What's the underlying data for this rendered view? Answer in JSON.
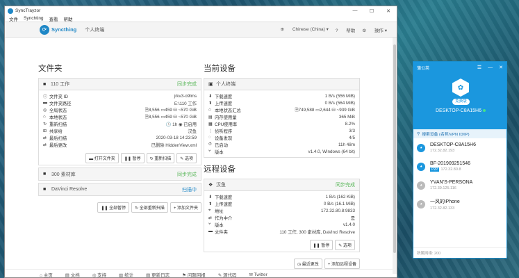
{
  "window": {
    "title": "SyncTrayzor",
    "min": "—",
    "max": "☐",
    "close": "✕"
  },
  "menu": [
    "文件",
    "Synchting",
    "查看",
    "帮助"
  ],
  "nav": {
    "logo": "Syncthing",
    "device": "个人终端",
    "language": "Chinese (China)",
    "help": "帮助",
    "actions": "操作"
  },
  "folders": {
    "heading": "文件夹",
    "main": {
      "name": "110 工作",
      "status": "同步完成",
      "rows": [
        {
          "icon": "ⓘ",
          "label": "文件夹 ID",
          "value": "jrkv3-o9lms"
        },
        {
          "icon": "▬",
          "label": "文件夹路径",
          "value": "E:\\110 工作"
        },
        {
          "icon": "◎",
          "label": "全局状态",
          "value": "🗎8,556  ▭459  ⛁ ~570 GiB"
        },
        {
          "icon": "⌂",
          "label": "本地状态",
          "value": "🗎8,556  ▭459  ⛁ ~570 GiB"
        },
        {
          "icon": "↻",
          "label": "重新扫描",
          "value": "🕓 1h  ◉ 已启用"
        },
        {
          "icon": "⊞",
          "label": "共享给",
          "value": "汉鱼"
        },
        {
          "icon": "⇄",
          "label": "最后扫描",
          "value": "2020-03-18 14:23:59"
        },
        {
          "icon": "⇄",
          "label": "最后更改",
          "value": "已删除 HiddenView.xml"
        }
      ],
      "buttons": [
        "打开文件夹",
        "暂停",
        "重新扫描",
        "选项"
      ]
    },
    "others": [
      {
        "name": "300 素材库",
        "status": "同步完成",
        "color": "green"
      },
      {
        "name": "DaVinci Resolve",
        "status": "扫描中",
        "color": "blue"
      }
    ],
    "buttons": [
      "全部暂停",
      "全部重新扫描",
      "添加文件夹"
    ]
  },
  "this_device": {
    "heading": "当前设备",
    "name": "个人终端",
    "rows": [
      {
        "icon": "⬇",
        "label": "下载速度",
        "value": "1 B/s (556 MiB)"
      },
      {
        "icon": "⬆",
        "label": "上传速度",
        "value": "0 B/s (564 MiB)"
      },
      {
        "icon": "⌂",
        "label": "本地状态汇总",
        "value": "🗎749,588  ▭2,644  ⛁ ~939 GiB"
      },
      {
        "icon": "▤",
        "label": "内存使用量",
        "value": "365 MiB"
      },
      {
        "icon": "▦",
        "label": "CPU使用率",
        "value": "8.2%"
      },
      {
        "icon": "⋮",
        "label": "侦听程序",
        "value": "3/3",
        "green": true
      },
      {
        "icon": "◌",
        "label": "设备发现",
        "value": "4/5"
      },
      {
        "icon": "⏱",
        "label": "已启动",
        "value": "11h 48m"
      },
      {
        "icon": "⑂",
        "label": "版本",
        "value": "v1.4.0, Windows (64 bit)"
      }
    ]
  },
  "remote": {
    "heading": "远程设备",
    "device": {
      "name": "汉鱼",
      "status": "同步完成",
      "rows": [
        {
          "icon": "⬇",
          "label": "下载速度",
          "value": "1 B/s (162 KiB)"
        },
        {
          "icon": "⬆",
          "label": "上传速度",
          "value": "0 B/s (16.1 MiB)"
        },
        {
          "icon": "⌖",
          "label": "地址",
          "value": "172.32.80.8:9833"
        },
        {
          "icon": "⇄",
          "label": "作为中介",
          "value": "是"
        },
        {
          "icon": "⑂",
          "label": "版本",
          "value": "v1.4.0"
        },
        {
          "icon": "▬",
          "label": "文件夹",
          "value": "110 工作, 300 素材库, DaVinci Resolve"
        }
      ],
      "buttons": [
        "暂停",
        "选项"
      ]
    },
    "buttons": [
      "最近更改",
      "添加远程设备"
    ]
  },
  "footer": [
    "主页",
    "文档",
    "支持",
    "统计",
    "更新日志",
    "问题回报",
    "源代码",
    "Twitter"
  ],
  "pgy": {
    "title": "蒲公英",
    "tb_icons": [
      "☰",
      "—",
      "✕"
    ],
    "badge": "免费版",
    "device": "DESKTOP-C8A15H6",
    "search": "搜索设备 (名称/VPN ID/IP)",
    "items": [
      {
        "name": "DESKTOP-C8A15H6",
        "ip": "172.32.82.193",
        "tag": "",
        "online": true
      },
      {
        "name": "BF-201909251546",
        "ip": "172.32.80.8",
        "tag": "P2P",
        "online": true
      },
      {
        "name": "YVAN’S-PERSONA",
        "ip": "172.39.125.116",
        "tag": "",
        "online": false
      },
      {
        "name": "一风的iPhone",
        "ip": "172.32.82.133",
        "tag": "",
        "online": false
      }
    ],
    "footer": "所属网络: 200"
  }
}
